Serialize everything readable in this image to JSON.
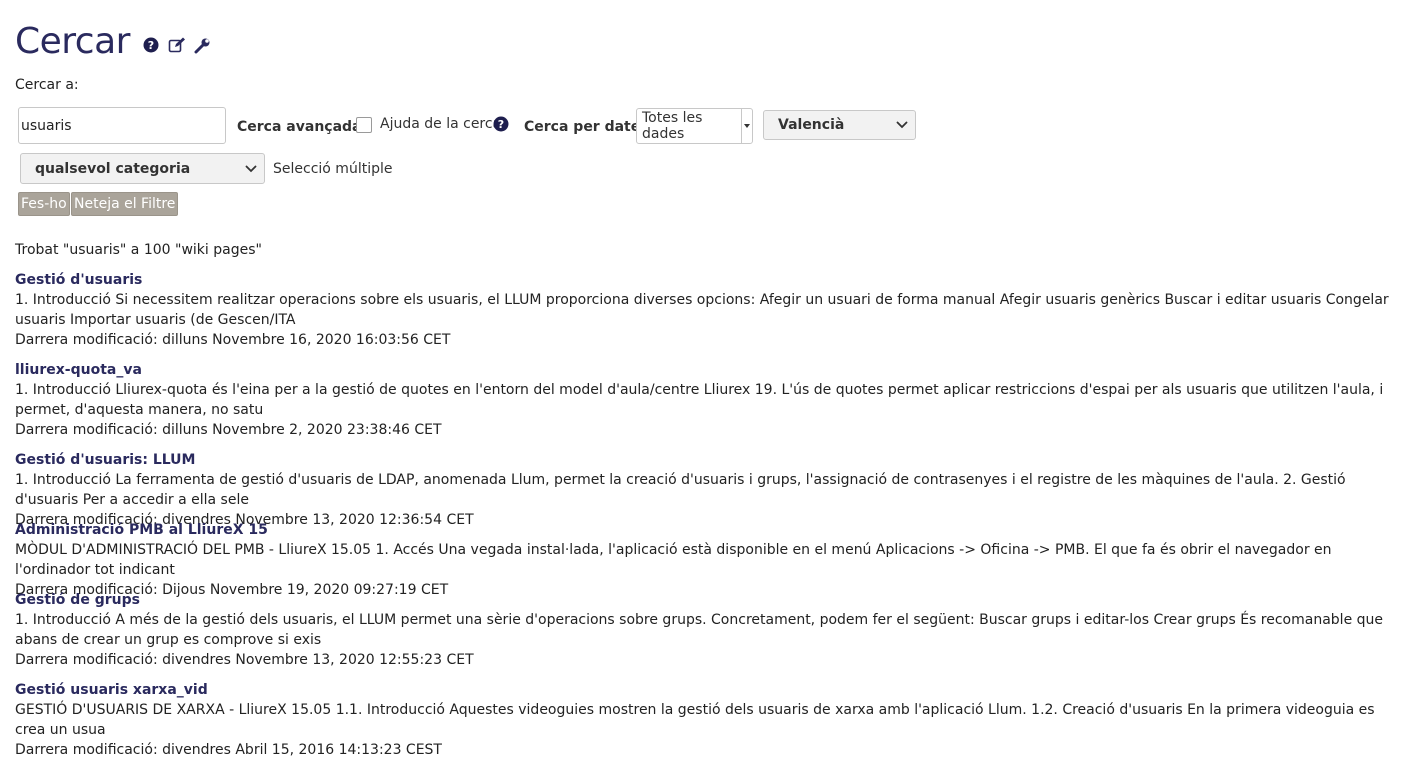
{
  "page": {
    "title": "Cercar",
    "icons": [
      "help-circle-icon",
      "edit-icon",
      "wrench-icon"
    ]
  },
  "form": {
    "search_in_label": "Cercar a:",
    "search_value": "usuaris",
    "advanced_label": "Cerca avançada:",
    "help_label": "Ajuda de la cerca",
    "date_label": "Cerca per dates:",
    "date_selected": "Totes les dades",
    "language_selected": "Valencià",
    "category_selected": "qualsevol categoria",
    "multi_select_label": "Selecció múltiple",
    "submit_label": "Fes-ho",
    "clear_label": "Neteja el Filtre"
  },
  "summary": "Trobat \"usuaris\" a 100 \"wiki pages\"",
  "results": [
    {
      "title": "Gestió d'usuaris",
      "snippet": "1. Introducció Si necessitem realitzar operacions sobre els usuaris, el LLUM proporciona diverses opcions: Afegir un usuari de forma manual Afegir usuaris genèrics Buscar i editar usuaris Congelar usuaris Importar usuaris (de Gescen/ITA",
      "modified": "Darrera modificació: dilluns Novembre 16, 2020 16:03:56 CET"
    },
    {
      "title": "lliurex-quota_va",
      "snippet": "1. Introducció Lliurex-quota és l'eina per a la gestió de quotes en l'entorn del model d'aula/centre Lliurex 19. L'ús de quotes permet aplicar restriccions d'espai per als usuaris que utilitzen l'aula, i permet, d'aquesta manera, no satu",
      "modified": "Darrera modificació: dilluns Novembre 2, 2020 23:38:46 CET"
    },
    {
      "title": "Gestió d'usuaris: LLUM",
      "snippet": "1. Introducció La ferramenta de gestió d'usuaris de LDAP, anomenada Llum, permet la creació d'usuaris i grups, l'assignació de contrasenyes i el registre de les màquines de l'aula. 2. Gestió d'usuaris   Per a accedir a ella sele",
      "modified": "Darrera modificació: divendres Novembre 13, 2020 12:36:54 CET"
    },
    {
      "title": "Administració PMB al LliureX 15",
      "snippet": "MÒDUL D'ADMINISTRACIÓ DEL PMB   - LliureX 15.05   1. Accés Una vegada instal·lada, l'aplicació està disponible en el menú Aplicacions -> Oficina -> PMB. El que fa és obrir el navegador en l'ordinador tot indicant",
      "modified": "Darrera modificació: Dijous Novembre 19, 2020 09:27:19 CET"
    },
    {
      "title": "Gestió de grups",
      "snippet": "1. Introducció  A més de la gestió dels usuaris, el LLUM permet una sèrie d'operacions sobre grups. Concretament, podem fer el següent: Buscar grups i editar-los Crear grups És recomanable que abans de crear un grup es comprove si exis",
      "modified": "Darrera modificació: divendres Novembre 13, 2020 12:55:23 CET"
    },
    {
      "title": "Gestió usuaris xarxa_vid",
      "snippet": "GESTIÓ D'USUARIS DE XARXA   - LliureX 15.05   1.1. Introducció   Aquestes videoguies mostren la gestió dels usuaris de xarxa amb l'aplicació Llum.     1.2. Creació d'usuaris En la primera videoguia es crea un usua",
      "modified": "Darrera modificació: divendres Abril 15, 2016 14:13:23 CEST"
    }
  ]
}
